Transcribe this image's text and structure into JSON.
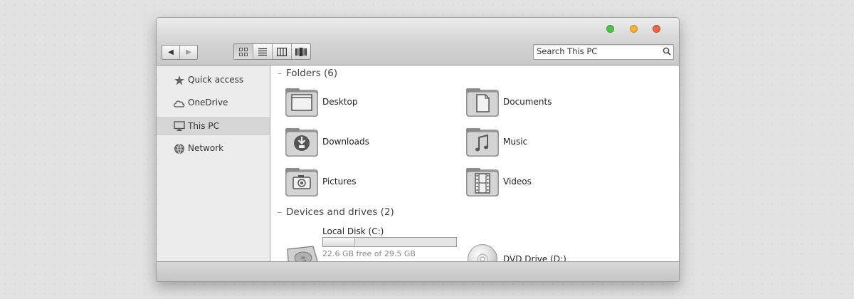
{
  "toolbar": {
    "back_icon": "back-arrow-icon",
    "forward_icon": "forward-arrow-icon",
    "views": [
      "large-icons-view-icon",
      "list-view-icon",
      "columns-view-icon",
      "coverflow-view-icon"
    ]
  },
  "search": {
    "placeholder": "Search This PC",
    "icon": "search-icon"
  },
  "sidebar": {
    "items": [
      {
        "label": "Quick access",
        "icon": "star-icon"
      },
      {
        "label": "OneDrive",
        "icon": "cloud-icon"
      },
      {
        "label": "This PC",
        "icon": "monitor-icon",
        "selected": true
      },
      {
        "label": "Network",
        "icon": "globe-icon"
      }
    ]
  },
  "folders": {
    "header": "Folders (6)",
    "items": [
      {
        "label": "Desktop",
        "icon": "desktop-folder-icon"
      },
      {
        "label": "Documents",
        "icon": "documents-folder-icon"
      },
      {
        "label": "Downloads",
        "icon": "downloads-folder-icon"
      },
      {
        "label": "Music",
        "icon": "music-folder-icon"
      },
      {
        "label": "Pictures",
        "icon": "pictures-folder-icon"
      },
      {
        "label": "Videos",
        "icon": "videos-folder-icon"
      }
    ]
  },
  "devices": {
    "header": "Devices and drives (2)",
    "items": [
      {
        "label": "Local Disk (C:)",
        "icon": "hard-disk-icon",
        "free_text": "22.6 GB free of 29.5 GB",
        "used_fraction": 0.234
      },
      {
        "label": "DVD Drive (D:)",
        "icon": "dvd-icon"
      }
    ]
  },
  "colors": {
    "traffic_green": "#4ec24a",
    "traffic_yellow": "#f1b23c",
    "traffic_red": "#ee6549",
    "selection": "#d6d6d6"
  }
}
